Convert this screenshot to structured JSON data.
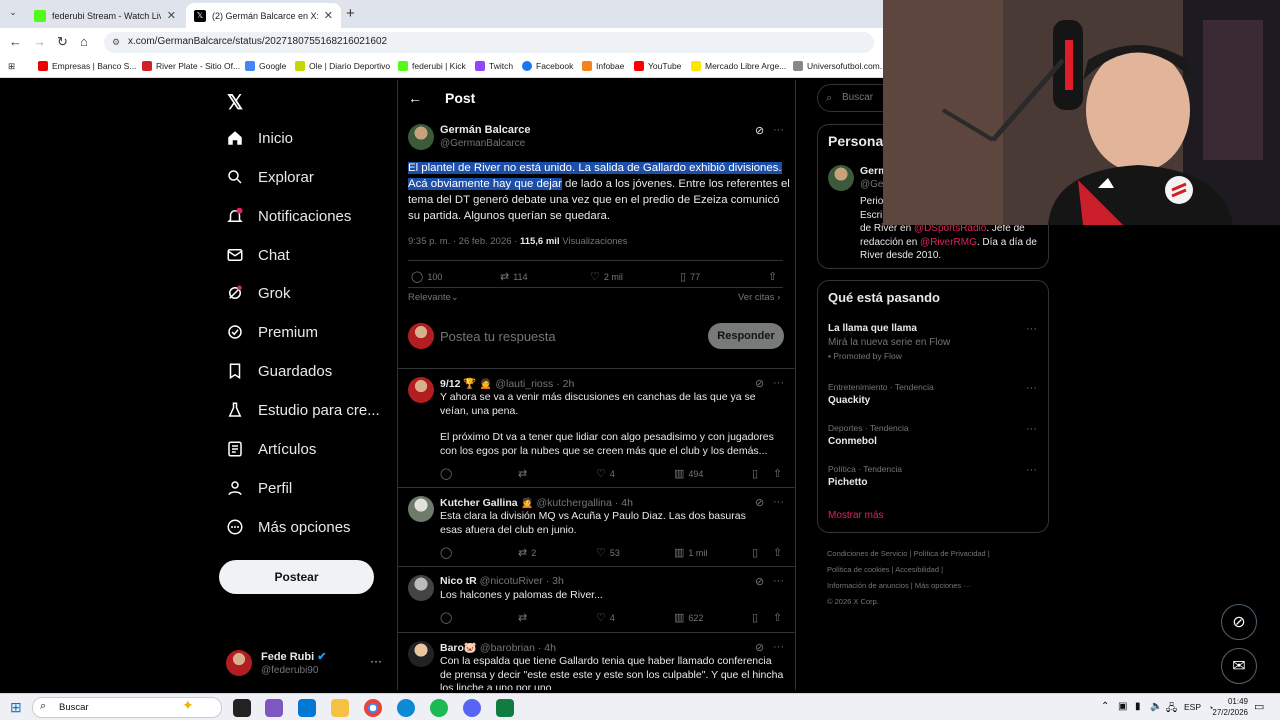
{
  "tabs": [
    {
      "title": "federubi Stream - Watch Live on",
      "favicon_color": "#53fc18",
      "active": false
    },
    {
      "title": "(2) Germán Balcarce en X: \"El pl",
      "favicon_color": "#000000",
      "active": true
    }
  ],
  "toolbar": {
    "url": "x.com/GermanBalcarce/status/2027180755168216021602"
  },
  "bookmarks": [
    {
      "label": "Empresas | Banco S...",
      "color": "#ec0000"
    },
    {
      "label": "River Plate - Sitio Of...",
      "color": "#d11f26"
    },
    {
      "label": "Google",
      "color": "#4285f4"
    },
    {
      "label": "Ole | Diario Deportivo",
      "color": "#c6d600"
    },
    {
      "label": "federubi | Kick",
      "color": "#53fc18"
    },
    {
      "label": "Twitch",
      "color": "#9146ff"
    },
    {
      "label": "Facebook",
      "color": "#1877f2"
    },
    {
      "label": "Infobae",
      "color": "#f58220"
    },
    {
      "label": "YouTube",
      "color": "#ff0000"
    },
    {
      "label": "Mercado Libre Arge...",
      "color": "#ffe600"
    },
    {
      "label": "Universofutbol.com...",
      "color": "#888888"
    }
  ],
  "sidebar": {
    "items": [
      {
        "label": "Inicio",
        "icon": "home-icon"
      },
      {
        "label": "Explorar",
        "icon": "search-icon"
      },
      {
        "label": "Notificaciones",
        "icon": "bell-icon",
        "badge": "2"
      },
      {
        "label": "Chat",
        "icon": "mail-icon"
      },
      {
        "label": "Grok",
        "icon": "grok-icon"
      },
      {
        "label": "Premium",
        "icon": "verified-icon"
      },
      {
        "label": "Guardados",
        "icon": "bookmark-icon"
      },
      {
        "label": "Estudio para cre...",
        "icon": "flask-icon"
      },
      {
        "label": "Artículos",
        "icon": "article-icon"
      },
      {
        "label": "Perfil",
        "icon": "person-icon"
      },
      {
        "label": "Más opciones",
        "icon": "more-circle-icon"
      }
    ],
    "post_button": "Postear",
    "account": {
      "name": "Fede Rubi",
      "handle": "@federubi90"
    }
  },
  "main": {
    "title": "Post",
    "post": {
      "name": "Germán Balcarce",
      "handle": "@GermanBalcarce",
      "text_highlighted": "El plantel de River no está unido. La salida de Gallardo exhibió divisiones. Acá obviamente hay que dejar",
      "text_rest": " de lado a los jóvenes. Entre los referentes el tema del DT generó debate una vez que en el predio de Ezeiza comunicó su partida. Algunos querían se quedara.",
      "time": "9:35 p. m. · 26 feb. 2026 ·",
      "views_count": "115,6 mil",
      "views_label": "Visualizaciones",
      "replies": "100",
      "reposts": "114",
      "likes": "2 mil",
      "bookmarks": "77",
      "sort": "Relevante",
      "quotes": "Ver citas"
    },
    "reply_box": {
      "placeholder": "Postea tu respuesta",
      "button": "Responder"
    },
    "replies": [
      {
        "name": "9/12 🏆 🙍",
        "handle": "@lauti_rioss · 2h",
        "text": "Y ahora se va a venir más discusiones en canchas de las que ya se veían, una pena.",
        "text2": "El próximo Dt va a tener que lidiar con algo pesadisimo y con jugadores con los egos por la nubes que se creen más que el club y los demás...",
        "replies": "",
        "reposts": "",
        "likes": "4",
        "views": "494"
      },
      {
        "name": "Kutcher Gallina 🙍",
        "handle": "@kutchergallina · 4h",
        "text": "Esta clara la división MQ vs Acuña y Paulo Diaz. Las dos basuras esas afuera del club en junio.",
        "text2": "",
        "replies": "",
        "reposts": "2",
        "likes": "53",
        "views": "1 mil"
      },
      {
        "name": "Nico tR",
        "handle": "@nicotuRiver · 3h",
        "text": "Los halcones y palomas de River...",
        "text2": "",
        "replies": "",
        "reposts": "",
        "likes": "4",
        "views": "622"
      },
      {
        "name": "Baro🐷",
        "handle": "@barobrian · 4h",
        "text": "Con la espalda que tiene Gallardo tenia que haber llamado conferencia de prensa y decir \"este este este y este son los culpable\". Y que el hincha los linche a uno por uno",
        "text2": "",
        "replies": "",
        "reposts": "",
        "likes": "",
        "views": ""
      }
    ]
  },
  "right": {
    "search_placeholder": "Buscar",
    "persona": {
      "heading": "Persona",
      "name": "Germ",
      "handle": "@Ge",
      "bio1": "Perio",
      "bio2": "Escri",
      "bio3_pre": "de River en ",
      "bio3_link": "@DSportsRadio",
      "bio3_post": ". Jefe de",
      "bio4_pre": "redacción en ",
      "bio4_link": "@RiverRMG",
      "bio4_post": ". Día a día de",
      "bio5": "River desde 2010."
    },
    "trends": {
      "heading": "Qué está pasando",
      "promo": {
        "title": "La llama que llama",
        "subtitle": "Mirá la nueva serie en Flow",
        "promoted": "Promoted by Flow"
      },
      "items": [
        {
          "meta": "Entretenimiento · Tendencia",
          "name": "Quackity"
        },
        {
          "meta": "Deportes · Tendencia",
          "name": "Conmebol"
        },
        {
          "meta": "Política · Tendencia",
          "name": "Pichetto"
        }
      ],
      "show_more": "Mostrar más"
    },
    "footer": {
      "l1a": "Condiciones de Servicio",
      "l1b": "Política de Privacidad",
      "l2a": "Política de cookies",
      "l2b": "Accesibilidad",
      "l3a": "Información de anuncios",
      "l3b": "Más opciones ···",
      "l4": "© 2026 X Corp."
    }
  },
  "taskbar": {
    "search": "Buscar",
    "lang": "ESP",
    "time": "01:49",
    "date": "27/2/2026"
  },
  "colors": {
    "accent": "#1d9bf0",
    "link": "#e0245e",
    "highlight": "#1d4fa8"
  }
}
